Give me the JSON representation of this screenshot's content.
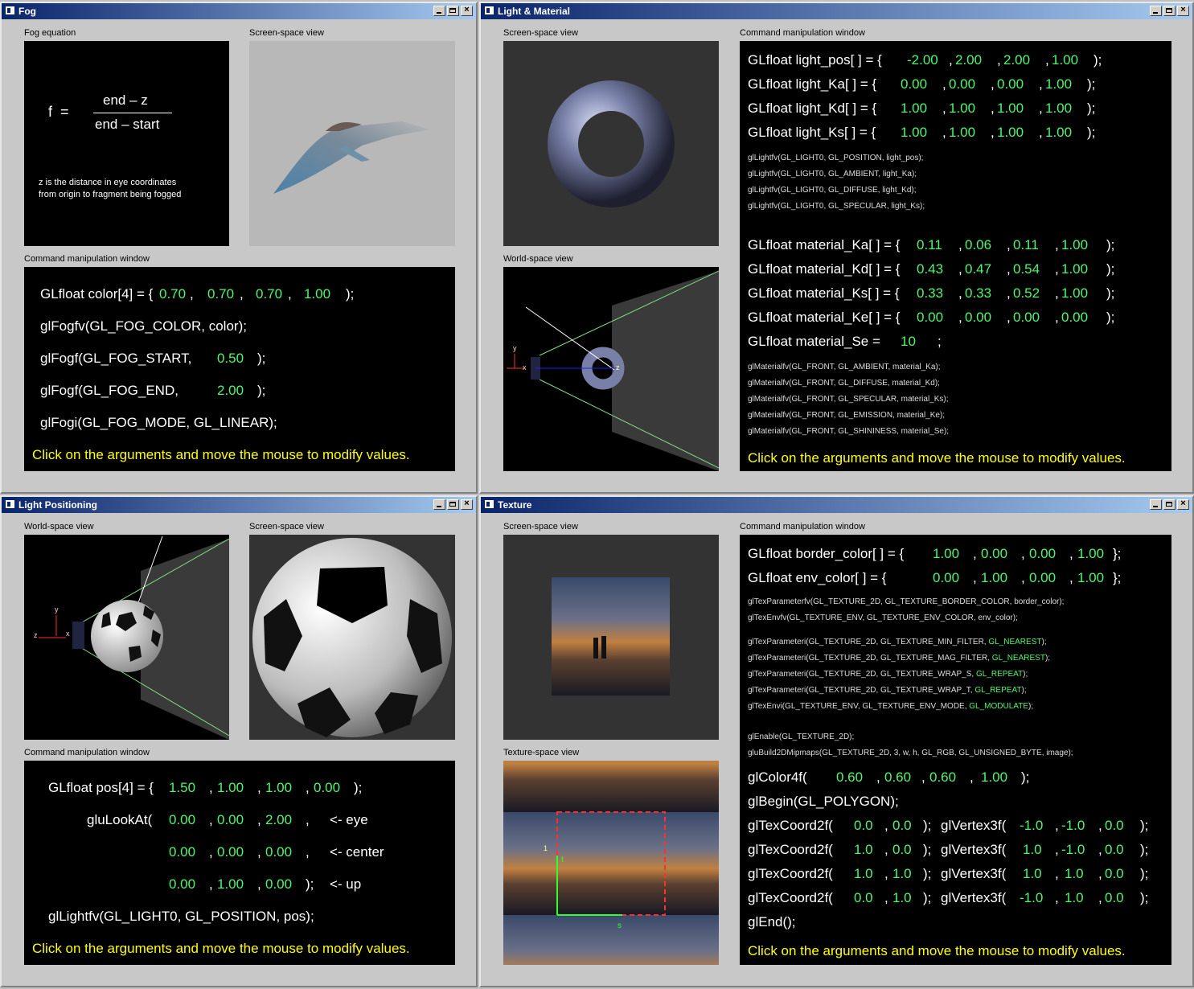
{
  "fog": {
    "title": "Fog",
    "equation_label": "Fog equation",
    "screen_label": "Screen-space view",
    "cmd_label": "Command manipulation window",
    "eq_f": "f  =",
    "eq_num": "end – z",
    "eq_den": "end – start",
    "eq_note1": "z is the distance in eye coordinates",
    "eq_note2": "from origin to fragment being fogged",
    "l1a": "GLfloat color[4] = {",
    "c0": "0.70",
    "c1": "0.70",
    "c2": "0.70",
    "c3": "1.00",
    "l2": "glFogfv(GL_FOG_COLOR, color);",
    "l3a": "glFogf(GL_FOG_START,",
    "start": "0.50",
    "l4a": "glFogf(GL_FOG_END,",
    "end": "2.00",
    "l5": "glFogi(GL_FOG_MODE, GL_LINEAR);",
    "hint": "Click on the arguments and move the mouse to modify values."
  },
  "lm": {
    "title": "Light & Material",
    "screen_label": "Screen-space view",
    "world_label": "World-space view",
    "cmd_label": "Command manipulation window",
    "pos_lbl": "GLfloat light_pos[ ] = {",
    "pos": [
      "-2.00",
      "2.00",
      "2.00",
      "1.00"
    ],
    "ka_lbl": "GLfloat light_Ka[ ] = {",
    "ka": [
      "0.00",
      "0.00",
      "0.00",
      "1.00"
    ],
    "kd_lbl": "GLfloat light_Kd[ ] = {",
    "kd": [
      "1.00",
      "1.00",
      "1.00",
      "1.00"
    ],
    "ks_lbl": "GLfloat light_Ks[ ] = {",
    "ks": [
      "1.00",
      "1.00",
      "1.00",
      "1.00"
    ],
    "small1": [
      "glLightfv(GL_LIGHT0, GL_POSITION, light_pos);",
      "glLightfv(GL_LIGHT0, GL_AMBIENT, light_Ka);",
      "glLightfv(GL_LIGHT0, GL_DIFFUSE, light_Kd);",
      "glLightfv(GL_LIGHT0, GL_SPECULAR, light_Ks);"
    ],
    "mka_lbl": "GLfloat material_Ka[ ] = {",
    "mka": [
      "0.11",
      "0.06",
      "0.11",
      "1.00"
    ],
    "mkd_lbl": "GLfloat material_Kd[ ] = {",
    "mkd": [
      "0.43",
      "0.47",
      "0.54",
      "1.00"
    ],
    "mks_lbl": "GLfloat material_Ks[ ] = {",
    "mks": [
      "0.33",
      "0.33",
      "0.52",
      "1.00"
    ],
    "mke_lbl": "GLfloat material_Ke[ ] = {",
    "mke": [
      "0.00",
      "0.00",
      "0.00",
      "0.00"
    ],
    "mse_lbl": "GLfloat material_Se =",
    "mse": "10",
    "small2": [
      "glMaterialfv(GL_FRONT, GL_AMBIENT, material_Ka);",
      "glMaterialfv(GL_FRONT, GL_DIFFUSE, material_Kd);",
      "glMaterialfv(GL_FRONT, GL_SPECULAR, material_Ks);",
      "glMaterialfv(GL_FRONT, GL_EMISSION, material_Ke);",
      "glMaterialfv(GL_FRONT, GL_SHININESS, material_Se);"
    ],
    "hint": "Click on the arguments and move the mouse to modify values."
  },
  "lp": {
    "title": "Light Positioning",
    "world_label": "World-space view",
    "screen_label": "Screen-space view",
    "cmd_label": "Command manipulation window",
    "l1": "GLfloat pos[4] = {",
    "pos": [
      "1.50",
      "1.00",
      "1.00",
      "0.00"
    ],
    "look": "gluLookAt(",
    "eye": [
      "0.00",
      "0.00",
      "2.00"
    ],
    "center": [
      "0.00",
      "0.00",
      "0.00"
    ],
    "up": [
      "0.00",
      "1.00",
      "0.00"
    ],
    "eye_lbl": "<- eye",
    "center_lbl": "<- center",
    "up_lbl": "<- up",
    "l5": "glLightfv(GL_LIGHT0, GL_POSITION, pos);",
    "hint": "Click on the arguments and move the mouse to modify values."
  },
  "tx": {
    "title": "Texture",
    "screen_label": "Screen-space view",
    "tex_label": "Texture-space view",
    "cmd_label": "Command manipulation window",
    "bc_lbl": "GLfloat border_color[ ] = {",
    "bc": [
      "1.00",
      "0.00",
      "0.00",
      "1.00"
    ],
    "ec_lbl": "GLfloat env_color[ ] = {",
    "ec": [
      "0.00",
      "1.00",
      "0.00",
      "1.00"
    ],
    "s1": [
      "glTexParameterfv(GL_TEXTURE_2D, GL_TEXTURE_BORDER_COLOR, border_color);",
      "glTexEnvfv(GL_TEXTURE_ENV, GL_TEXTURE_ENV_COLOR, env_color);"
    ],
    "s2": [
      {
        "t": "glTexParameteri(GL_TEXTURE_2D, GL_TEXTURE_MIN_FILTER, ",
        "v": "GL_NEAREST"
      },
      {
        "t": "glTexParameteri(GL_TEXTURE_2D, GL_TEXTURE_MAG_FILTER, ",
        "v": "GL_NEAREST"
      },
      {
        "t": "glTexParameteri(GL_TEXTURE_2D, GL_TEXTURE_WRAP_S, ",
        "v": "GL_REPEAT"
      },
      {
        "t": "glTexParameteri(GL_TEXTURE_2D, GL_TEXTURE_WRAP_T, ",
        "v": "GL_REPEAT"
      },
      {
        "t": "glTexEnvi(GL_TEXTURE_ENV, GL_TEXTURE_ENV_MODE, ",
        "v": "GL_MODULATE"
      }
    ],
    "s3": [
      "glEnable(GL_TEXTURE_2D);",
      "gluBuild2DMipmaps(GL_TEXTURE_2D, 3, w, h, GL_RGB, GL_UNSIGNED_BYTE, image);"
    ],
    "col_lbl": "glColor4f(",
    "col": [
      "0.60",
      "0.60",
      "0.60",
      "1.00"
    ],
    "begin": "glBegin(GL_POLYGON);",
    "tc_lbl": "glTexCoord2f(",
    "v_lbl": "glVertex3f(",
    "rows": [
      {
        "tc": [
          "0.0",
          "0.0"
        ],
        "v": [
          "-1.0",
          "-1.0",
          "0.0"
        ]
      },
      {
        "tc": [
          "1.0",
          "0.0"
        ],
        "v": [
          "1.0",
          "-1.0",
          "0.0"
        ]
      },
      {
        "tc": [
          "1.0",
          "1.0"
        ],
        "v": [
          "1.0",
          "1.0",
          "0.0"
        ]
      },
      {
        "tc": [
          "0.0",
          "1.0"
        ],
        "v": [
          "-1.0",
          "1.0",
          "0.0"
        ]
      }
    ],
    "end": "glEnd();",
    "hint": "Click on the arguments and move the mouse to modify values."
  },
  "axis_y": "y",
  "axis_z": "z",
  "axis_x": "x",
  "axis_s": "s",
  "axis_t": "t",
  "tex_one": "1",
  "accent_green": "#4cf86a",
  "accent_yellow": "#ffff00"
}
